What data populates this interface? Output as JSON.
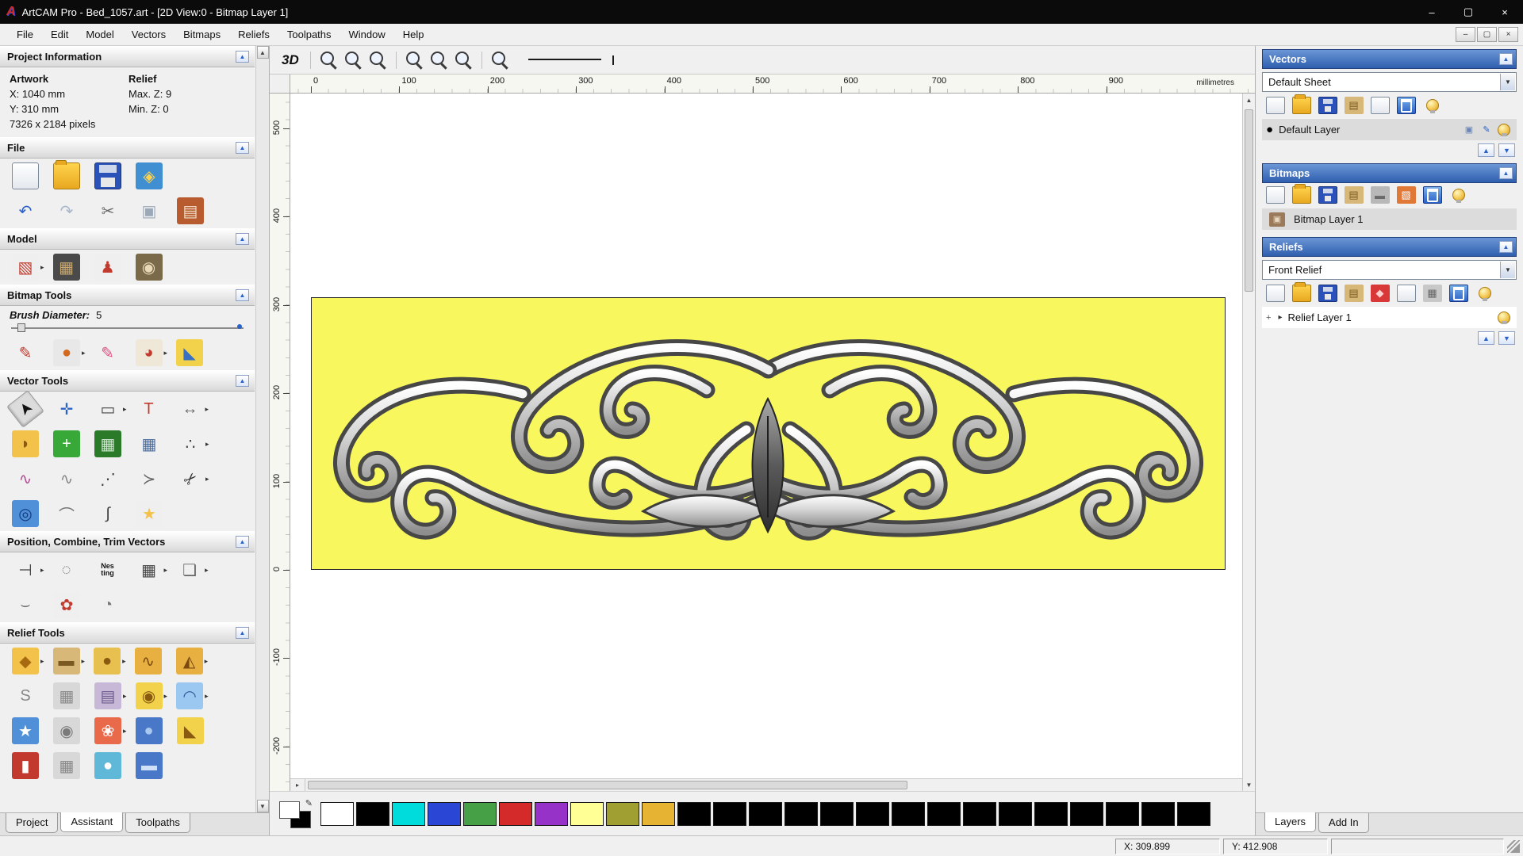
{
  "icons": {
    "collapse_up": "▲",
    "dropdown": "▼",
    "flyout": "▸",
    "scroll_up": "▲",
    "scroll_down": "▼",
    "scroll_left": "◂",
    "plus": "+",
    "pen": "✎"
  },
  "window": {
    "title": "ArtCAM Pro - Bed_1057.art - [2D View:0 - Bitmap Layer 1]",
    "logo_letter": "A",
    "controls": [
      {
        "n": "minimize-button",
        "t": "win",
        "g": "–"
      },
      {
        "n": "maximize-button",
        "t": "win",
        "g": "▢"
      },
      {
        "n": "close-button",
        "t": "win",
        "g": "×"
      }
    ]
  },
  "menubar": {
    "items": [
      {
        "label": "File"
      },
      {
        "label": "Edit"
      },
      {
        "label": "Model"
      },
      {
        "label": "Vectors"
      },
      {
        "label": "Bitmaps"
      },
      {
        "label": "Reliefs"
      },
      {
        "label": "Toolpaths"
      },
      {
        "label": "Window"
      },
      {
        "label": "Help"
      }
    ],
    "mdi_controls": [
      {
        "n": "mdi-minimize-button",
        "t": "winsm",
        "g": "–"
      },
      {
        "n": "mdi-restore-button",
        "t": "winsm",
        "g": "▢"
      },
      {
        "n": "mdi-close-button",
        "t": "winsm",
        "g": "×"
      }
    ]
  },
  "left_panel": {
    "project_information": {
      "title": "Project Information",
      "artwork_label": "Artwork",
      "artwork_x": "X: 1040 mm",
      "artwork_y": "Y: 310 mm",
      "artwork_pixels": "7326 x 2184 pixels",
      "relief_label": "Relief",
      "relief_max_z": "Max. Z: 9",
      "relief_min_z": "Min. Z: 0"
    },
    "file": {
      "title": "File",
      "row1": [
        {
          "n": "new-model-icon",
          "t": "page"
        },
        {
          "n": "open-model-icon",
          "t": "folder"
        },
        {
          "n": "save-model-icon",
          "t": "floppy"
        },
        {
          "n": "import-3d-model-icon",
          "t": "generic",
          "c": "#3f8fd2",
          "g": "◈",
          "fg": "#ffd34d"
        }
      ],
      "row2": [
        {
          "n": "undo-icon",
          "t": "plain",
          "g": "↶",
          "fg": "#2a62c8"
        },
        {
          "n": "redo-icon",
          "t": "plain",
          "g": "↷",
          "fg": "#a8b8cc"
        },
        {
          "n": "cut-icon",
          "t": "plain",
          "g": "✂",
          "fg": "#666666"
        },
        {
          "n": "copy-icon",
          "t": "plain",
          "g": "▣",
          "fg": "#9aa8b8"
        },
        {
          "n": "paste-icon",
          "t": "generic",
          "c": "#b85c30",
          "g": "▤",
          "fg": "#f2e0c8"
        }
      ]
    },
    "model": {
      "title": "Model",
      "row": [
        {
          "n": "set-model-size-icon",
          "t": "generic",
          "c": "#efefef",
          "g": "▧",
          "fg": "#c23a2e",
          "fly": true
        },
        {
          "n": "model-texture-icon",
          "t": "generic",
          "c": "#4a4a4a",
          "g": "▦",
          "fg": "#c8a870"
        },
        {
          "n": "sculpting-icon",
          "t": "generic",
          "c": "#efefef",
          "g": "♟",
          "fg": "#c23a2e"
        },
        {
          "n": "face-wizard-icon",
          "t": "generic",
          "c": "#7a6a4a",
          "g": "◉",
          "fg": "#e8d8b8"
        }
      ]
    },
    "bitmap_tools": {
      "title": "Bitmap Tools",
      "brush_label": "Brush Diameter:",
      "brush_value": "5",
      "row": [
        {
          "n": "paint-brush-icon",
          "t": "plain",
          "g": "✎",
          "fg": "#c23a2e"
        },
        {
          "n": "paint-selective-icon",
          "t": "generic",
          "c": "#e8e8e8",
          "g": "●",
          "fg": "#d2691e",
          "fly": true
        },
        {
          "n": "flood-fill-icon",
          "t": "plain",
          "g": "✎",
          "fg": "#e05080"
        },
        {
          "n": "colour-palette-icon",
          "t": "generic",
          "c": "#efe8d8",
          "g": "◕",
          "fg": "#c23a2e",
          "fly": true
        },
        {
          "n": "paint-bucket-icon",
          "t": "generic",
          "c": "#f2d24a",
          "g": "◣",
          "fg": "#3a70c0"
        }
      ]
    },
    "vector_tools": {
      "title": "Vector Tools",
      "row1": [
        {
          "n": "select-vectors-icon",
          "t": "pressed",
          "g": "➤",
          "fg": "#111111",
          "rot": -128
        },
        {
          "n": "transform-vectors-icon",
          "t": "plain",
          "g": "✛",
          "fg": "#2a62c8"
        },
        {
          "n": "create-rectangle-icon",
          "t": "plain",
          "g": "▭",
          "fg": "#444444",
          "fly": true
        },
        {
          "n": "create-text-icon",
          "t": "plain",
          "g": "T",
          "fg": "#c23a2e"
        },
        {
          "n": "measure-icon",
          "t": "plain",
          "g": "↔",
          "fg": "#666666",
          "fly": true
        }
      ],
      "row2": [
        {
          "n": "offset-vectors-icon",
          "t": "generic",
          "c": "#f2c24a",
          "g": "◗",
          "fg": "#8a5a10"
        },
        {
          "n": "node-editing-icon",
          "t": "generic",
          "c": "#38a838",
          "g": "+",
          "fg": "#ffffff"
        },
        {
          "n": "bitmap-to-vector-icon",
          "t": "generic",
          "c": "#2a7a2a",
          "g": "▦",
          "fg": "#cfe8cf"
        },
        {
          "n": "snap-grid-settings-icon",
          "t": "plain",
          "g": "▦",
          "fg": "#4a6a9a"
        },
        {
          "n": "paste-along-curve-icon",
          "t": "plain",
          "g": "∴",
          "fg": "#444444",
          "fly": true
        }
      ],
      "row3": [
        {
          "n": "fit-curve-icon",
          "t": "plain",
          "g": "∿",
          "fg": "#b05090"
        },
        {
          "n": "smooth-curve-icon",
          "t": "plain",
          "g": "∿",
          "fg": "#888888"
        },
        {
          "n": "create-polyline-icon",
          "t": "plain",
          "g": "⋰",
          "fg": "#444444"
        },
        {
          "n": "arc-icon",
          "t": "plain",
          "g": "≻",
          "fg": "#666666"
        },
        {
          "n": "trim-vectors-icon",
          "t": "plain",
          "g": "✂",
          "fg": "#333333",
          "rot": -45,
          "fly": true
        }
      ],
      "row4": [
        {
          "n": "create-circle-icon",
          "t": "generic",
          "c": "#5090d8",
          "g": "◎",
          "fg": "#103a7a"
        },
        {
          "n": "create-arc-icon",
          "t": "plain",
          "g": "⌒",
          "fg": "#777777"
        },
        {
          "n": "join-vectors-icon",
          "t": "plain",
          "g": "∫",
          "fg": "#444444"
        },
        {
          "n": "create-star-icon",
          "t": "generic",
          "c": "#efefef",
          "g": "★",
          "fg": "#f2c24a"
        }
      ]
    },
    "position_tools": {
      "title": "Position, Combine, Trim Vectors",
      "row1": [
        {
          "n": "align-vectors-icon",
          "t": "plain",
          "g": "⊣",
          "fg": "#444444",
          "fly": true
        },
        {
          "n": "circular-array-icon",
          "t": "plain",
          "g": "◌",
          "fg": "#666666"
        },
        {
          "n": "nesting-icon",
          "t": "nes",
          "g": "Nes\nting"
        },
        {
          "n": "block-array-icon",
          "t": "plain",
          "g": "▦",
          "fg": "#444444",
          "fly": true
        },
        {
          "n": "copy-rotate-icon",
          "t": "plain",
          "g": "❏",
          "fg": "#666666",
          "fly": true
        }
      ],
      "row2": [
        {
          "n": "fit-vectors-to-curve-icon",
          "t": "plain",
          "g": "⌣",
          "fg": "#666666"
        },
        {
          "n": "weld-vectors-icon",
          "t": "generic",
          "c": "#efefef",
          "g": "✿",
          "fg": "#c23a2e"
        },
        {
          "n": "ring-copy-icon",
          "t": "plain",
          "g": "◔",
          "fg": "#777777"
        }
      ]
    },
    "relief_tools": {
      "title": "Relief Tools",
      "row1": [
        {
          "n": "shape-editor-icon",
          "t": "generic",
          "c": "#f2c24a",
          "g": "◆",
          "fg": "#a86a10",
          "fly": true
        },
        {
          "n": "smooth-relief-icon",
          "t": "generic",
          "c": "#d8b878",
          "g": "▬",
          "fg": "#7a5a20",
          "fly": true
        },
        {
          "n": "sculpting-tools-icon",
          "t": "generic",
          "c": "#e8c050",
          "g": "●",
          "fg": "#8a5a10",
          "fly": true
        },
        {
          "n": "two-rail-sweep-icon",
          "t": "generic",
          "c": "#e8b040",
          "g": "∿",
          "fg": "#7a4a10"
        },
        {
          "n": "extrude-icon",
          "t": "generic",
          "c": "#e8b040",
          "g": "◭",
          "fg": "#7a4a10",
          "fly": true
        }
      ],
      "row2": [
        {
          "n": "spin-relief-icon",
          "t": "plain",
          "g": "S",
          "fg": "#888888"
        },
        {
          "n": "weave-wizard-icon",
          "t": "generic",
          "c": "#d8d8d8",
          "g": "▦",
          "fg": "#8a8a8a"
        },
        {
          "n": "texture-relief-icon",
          "t": "generic",
          "c": "#c8b8d8",
          "g": "▤",
          "fg": "#6a5a8a",
          "fly": true
        },
        {
          "n": "interactive-distort-icon",
          "t": "generic",
          "c": "#f2d24a",
          "g": "◉",
          "fg": "#8a5a10",
          "fly": true
        },
        {
          "n": "envelope-distort-icon",
          "t": "generic",
          "c": "#9ac8f0",
          "g": "◠",
          "fg": "#2a5a9a",
          "fly": true
        }
      ],
      "row3": [
        {
          "n": "star-wizard-icon",
          "t": "generic",
          "c": "#5090d8",
          "g": "★",
          "fg": "#ffffff"
        },
        {
          "n": "face-relief-icon",
          "t": "generic",
          "c": "#d8d8d8",
          "g": "◉",
          "fg": "#7a7a7a"
        },
        {
          "n": "fan-relief-icon",
          "t": "generic",
          "c": "#e86a4a",
          "g": "❀",
          "fg": "#ffffff",
          "fly": true
        },
        {
          "n": "texture-sphere-icon",
          "t": "generic",
          "c": "#4a78c8",
          "g": "●",
          "fg": "#a8c8f0"
        },
        {
          "n": "wedge-relief-icon",
          "t": "generic",
          "c": "#f2d24a",
          "g": "◣",
          "fg": "#8a5a10"
        }
      ],
      "row4": [
        {
          "n": "relief-tool-extra-1-icon",
          "t": "generic",
          "c": "#c23a2e",
          "g": "▮",
          "fg": "#ffffff"
        },
        {
          "n": "relief-tool-extra-2-icon",
          "t": "generic",
          "c": "#d8d8d8",
          "g": "▦",
          "fg": "#888888"
        },
        {
          "n": "relief-tool-extra-3-icon",
          "t": "generic",
          "c": "#60b8d8",
          "g": "●",
          "fg": "#ffffff"
        },
        {
          "n": "relief-tool-extra-4-icon",
          "t": "generic",
          "c": "#4a78c8",
          "g": "▬",
          "fg": "#cfe0f8"
        }
      ]
    },
    "tabs": [
      {
        "label": "Project"
      },
      {
        "label": "Assistant"
      },
      {
        "label": "Toolpaths"
      }
    ]
  },
  "canvas": {
    "view3d_label": "3D",
    "toolbar": [
      {
        "n": "zoom-in-icon",
        "t": "mag",
        "g": "+"
      },
      {
        "n": "zoom-out-icon",
        "t": "mag",
        "g": "−"
      },
      {
        "n": "zoom-window-icon",
        "t": "mag",
        "g": "▭"
      },
      {
        "sep": true
      },
      {
        "n": "zoom-fit-icon",
        "t": "mag",
        "g": "▣"
      },
      {
        "n": "zoom-objects-icon",
        "t": "mag",
        "g": "▤"
      },
      {
        "n": "zoom-previous-icon",
        "t": "mag",
        "g": "◂"
      },
      {
        "sep": true
      },
      {
        "n": "pan-view-icon",
        "t": "mag",
        "g": "✛"
      }
    ],
    "ruler_h": [
      "0",
      "100",
      "200",
      "300",
      "400",
      "500",
      "600",
      "700",
      "800",
      "900"
    ],
    "ruler_v": [
      "500",
      "400",
      "300",
      "200",
      "100",
      "0",
      "-100",
      "-200"
    ],
    "units_label": "millimetres"
  },
  "right_panel": {
    "vectors": {
      "title": "Vectors",
      "sheet_value": "Default Sheet",
      "toolbar": [
        {
          "n": "new-vector-layer-icon",
          "t": "page"
        },
        {
          "n": "open-vectors-icon",
          "t": "folder"
        },
        {
          "n": "save-vectors-icon",
          "t": "floppy"
        },
        {
          "n": "merge-vector-layers-icon",
          "t": "generic",
          "c": "#d8b878",
          "g": "▤",
          "fg": "#7a5a20"
        },
        {
          "n": "new-sheet-icon",
          "t": "page"
        },
        {
          "n": "delete-vector-layer-icon",
          "t": "trash"
        },
        {
          "n": "show-all-vector-layers-icon",
          "t": "bulb"
        }
      ],
      "layer_name": "Default Layer",
      "layer_icons": [
        {
          "n": "layer-snap-icon",
          "t": "plain",
          "g": "▣",
          "fg": "#6a86b8"
        },
        {
          "n": "layer-edit-colour-icon",
          "t": "plain",
          "g": "✎",
          "fg": "#2a62c8"
        },
        {
          "n": "layer-visibility-icon",
          "t": "bulb"
        }
      ]
    },
    "bitmaps": {
      "title": "Bitmaps",
      "toolbar": [
        {
          "n": "new-bitmap-layer-icon",
          "t": "page"
        },
        {
          "n": "open-bitmap-icon",
          "t": "folder"
        },
        {
          "n": "save-bitmap-icon",
          "t": "floppy"
        },
        {
          "n": "merge-bitmap-layers-icon",
          "t": "generic",
          "c": "#d8b878",
          "g": "▤",
          "fg": "#7a5a20"
        },
        {
          "n": "greyscale-bitmap-icon",
          "t": "generic",
          "c": "#b8b8b8",
          "g": "▬",
          "fg": "#6a6a6a"
        },
        {
          "n": "colour-reduce-icon",
          "t": "generic",
          "c": "#e07838",
          "g": "▧",
          "fg": "#ffffff"
        },
        {
          "n": "delete-bitmap-layer-icon",
          "t": "trash"
        },
        {
          "n": "show-all-bitmap-layers-icon",
          "t": "bulb"
        }
      ],
      "layer_name": "Bitmap Layer 1"
    },
    "reliefs": {
      "title": "Reliefs",
      "selected_value": "Front Relief",
      "toolbar": [
        {
          "n": "new-relief-layer-icon",
          "t": "page"
        },
        {
          "n": "open-relief-icon",
          "t": "folder"
        },
        {
          "n": "save-relief-icon",
          "t": "floppy"
        },
        {
          "n": "merge-relief-layers-icon",
          "t": "generic",
          "c": "#d8b878",
          "g": "▤",
          "fg": "#7a5a20"
        },
        {
          "n": "reset-relief-icon",
          "t": "generic",
          "c": "#d83838",
          "g": "◆",
          "fg": "#ffd0d0"
        },
        {
          "n": "duplicate-relief-icon",
          "t": "page"
        },
        {
          "n": "relief-grid-icon",
          "t": "generic",
          "c": "#c8c8c8",
          "g": "▦",
          "fg": "#666666"
        },
        {
          "n": "delete-relief-layer-icon",
          "t": "trash"
        },
        {
          "n": "show-all-relief-layers-icon",
          "t": "bulb"
        }
      ],
      "layer_name": "Relief Layer 1"
    },
    "tabs": [
      {
        "label": "Layers"
      },
      {
        "label": "Add In"
      }
    ]
  },
  "palette": {
    "colors": [
      "#ffffff",
      "#000000",
      "#00dcdc",
      "#2a46d4",
      "#46a046",
      "#d42a2a",
      "#9632c8",
      "#ffff96",
      "#a0a032",
      "#e6b432",
      "#000000",
      "#000000",
      "#000000",
      "#000000",
      "#000000",
      "#000000",
      "#000000",
      "#000000",
      "#000000",
      "#000000",
      "#000000",
      "#000000",
      "#000000",
      "#000000",
      "#000000"
    ]
  },
  "statusbar": {
    "coord_x": "X: 309.899",
    "coord_y": "Y: 412.908"
  }
}
